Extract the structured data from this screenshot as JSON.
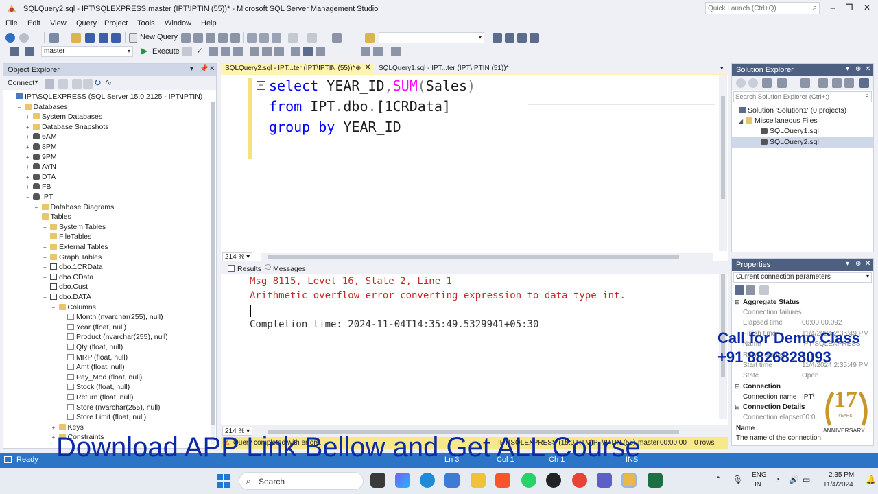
{
  "window": {
    "title": "SQLQuery2.sql - IPT\\SQLEXPRESS.master (IPT\\IPTIN (55))* - Microsoft SQL Server Management Studio",
    "quick_launch_placeholder": "Quick Launch (Ctrl+Q)"
  },
  "menu": [
    "File",
    "Edit",
    "View",
    "Query",
    "Project",
    "Tools",
    "Window",
    "Help"
  ],
  "toolbar": {
    "new_query": "New Query",
    "database": "master",
    "execute": "Execute"
  },
  "object_explorer": {
    "title": "Object Explorer",
    "connect": "Connect",
    "nodes": [
      {
        "label": "IPT\\SQLEXPRESS (SQL Server 15.0.2125 - IPT\\IPTIN)",
        "type": "server",
        "level": 0,
        "exp": "−"
      },
      {
        "label": "Databases",
        "type": "folder",
        "level": 1,
        "exp": "−"
      },
      {
        "label": "System Databases",
        "type": "folder",
        "level": 2,
        "exp": "+"
      },
      {
        "label": "Database Snapshots",
        "type": "folder",
        "level": 2,
        "exp": "+"
      },
      {
        "label": "6AM",
        "type": "db",
        "level": 2,
        "exp": "+"
      },
      {
        "label": "8PM",
        "type": "db",
        "level": 2,
        "exp": "+"
      },
      {
        "label": "9PM",
        "type": "db",
        "level": 2,
        "exp": "+"
      },
      {
        "label": "AYN",
        "type": "db",
        "level": 2,
        "exp": "+"
      },
      {
        "label": "DTA",
        "type": "db",
        "level": 2,
        "exp": "+"
      },
      {
        "label": "FB",
        "type": "db",
        "level": 2,
        "exp": "+"
      },
      {
        "label": "IPT",
        "type": "db",
        "level": 2,
        "exp": "−"
      },
      {
        "label": "Database Diagrams",
        "type": "folder",
        "level": 3,
        "exp": "+"
      },
      {
        "label": "Tables",
        "type": "folder",
        "level": 3,
        "exp": "−"
      },
      {
        "label": "System Tables",
        "type": "folder",
        "level": 4,
        "exp": "+"
      },
      {
        "label": "FileTables",
        "type": "folder",
        "level": 4,
        "exp": "+"
      },
      {
        "label": "External Tables",
        "type": "folder",
        "level": 4,
        "exp": "+"
      },
      {
        "label": "Graph Tables",
        "type": "folder",
        "level": 4,
        "exp": "+"
      },
      {
        "label": "dbo.1CRData",
        "type": "table",
        "level": 4,
        "exp": "+"
      },
      {
        "label": "dbo.CData",
        "type": "table",
        "level": 4,
        "exp": "+"
      },
      {
        "label": "dbo.Cust",
        "type": "table",
        "level": 4,
        "exp": "+"
      },
      {
        "label": "dbo.DATA",
        "type": "table",
        "level": 4,
        "exp": "−"
      },
      {
        "label": "Columns",
        "type": "folder",
        "level": 5,
        "exp": "−"
      },
      {
        "label": "Month (nvarchar(255), null)",
        "type": "column",
        "level": 6,
        "exp": ""
      },
      {
        "label": "Year (float, null)",
        "type": "column",
        "level": 6,
        "exp": ""
      },
      {
        "label": "Product (nvarchar(255), null)",
        "type": "column",
        "level": 6,
        "exp": ""
      },
      {
        "label": "Qty (float, null)",
        "type": "column",
        "level": 6,
        "exp": ""
      },
      {
        "label": "MRP (float, null)",
        "type": "column",
        "level": 6,
        "exp": ""
      },
      {
        "label": "Amt (float, null)",
        "type": "column",
        "level": 6,
        "exp": ""
      },
      {
        "label": "Pay_Mod (float, null)",
        "type": "column",
        "level": 6,
        "exp": ""
      },
      {
        "label": "Stock (float, null)",
        "type": "column",
        "level": 6,
        "exp": ""
      },
      {
        "label": "Return (float, null)",
        "type": "column",
        "level": 6,
        "exp": ""
      },
      {
        "label": "Store (nvarchar(255), null)",
        "type": "column",
        "level": 6,
        "exp": ""
      },
      {
        "label": "Store Limit (float, null)",
        "type": "column",
        "level": 6,
        "exp": ""
      },
      {
        "label": "Keys",
        "type": "folder",
        "level": 5,
        "exp": "+"
      },
      {
        "label": "Constraints",
        "type": "folder",
        "level": 5,
        "exp": "+"
      }
    ]
  },
  "editor": {
    "tabs": [
      {
        "label": "SQLQuery2.sql - IPT...ter (IPT\\IPTIN (55))*",
        "active": true
      },
      {
        "label": "SQLQuery1.sql - IPT...ter (IPT\\IPTIN (51))*",
        "active": false
      }
    ],
    "zoom": "214 %",
    "line1": {
      "kw": "select",
      "a": " YEAR_ID",
      "b": ",",
      "fn": "SUM",
      "c": "(",
      "d": "Sales",
      "e": ")"
    },
    "line2": {
      "kw": "from",
      "a": " IPT",
      "b": ".",
      "c": "dbo",
      "d": ".",
      "e": "[1CRData]"
    },
    "line3": {
      "kw": "group by",
      "a": " YEAR_ID"
    }
  },
  "results": {
    "tab_results": "Results",
    "tab_messages": "Messages",
    "msg1": "Msg 8115, Level 16, State 2, Line 1",
    "msg2": "Arithmetic overflow error converting expression to data type int.",
    "completion": "Completion time: 2024-11-04T14:35:49.5329941+05:30",
    "zoom": "214 %"
  },
  "query_status": {
    "text": "Query completed with errors.",
    "server": "IPT\\SQLEXPRESS (15.0 RTM)",
    "user": "IPT\\IPTIN (55)",
    "db": "master",
    "time": "00:00:00",
    "rows": "0 rows"
  },
  "statusbar": {
    "ready": "Ready",
    "ln": "Ln 3",
    "col": "Col 1",
    "ch": "Ch 1",
    "ins": "INS"
  },
  "solution_explorer": {
    "title": "Solution Explorer",
    "search_placeholder": "Search Solution Explorer (Ctrl+;)",
    "solution": "Solution 'Solution1' (0 projects)",
    "misc": "Miscellaneous Files",
    "file1": "SQLQuery1.sql",
    "file2": "SQLQuery2.sql"
  },
  "properties": {
    "title": "Properties",
    "selector": "Current connection parameters",
    "cat_aggregate": "Aggregate Status",
    "rows": [
      {
        "k": "Connection failures",
        "v": ""
      },
      {
        "k": "Elapsed time",
        "v": "00:00:00.092"
      },
      {
        "k": "Finish time",
        "v": "11/4/2024 2:35:49 PM"
      },
      {
        "k": "Name",
        "v": "IPT\\SQLEXPRESS"
      },
      {
        "k": "Rows returned",
        "v": "0"
      },
      {
        "k": "Start time",
        "v": "11/4/2024 2:35:49 PM"
      },
      {
        "k": "State",
        "v": "Open"
      }
    ],
    "cat_connection": "Connection",
    "conn_name_k": "Connection name",
    "conn_name_v": "IPT\\",
    "cat_details": "Connection Details",
    "conn_elapsed_k": "Connection elapsed",
    "conn_elapsed_v": "00:0",
    "desc_title": "Name",
    "desc_text": "The name of the connection."
  },
  "promo": {
    "line1": "Call for Demo Class",
    "line2": "+91 8826828093",
    "banner": "Download APP Link Bellow and Get ALL Course",
    "badge_number": "17",
    "badge_years": "YEARS",
    "badge_text": "ANNIVERSARY"
  },
  "taskbar": {
    "search": "Search",
    "lang1": "ENG",
    "lang2": "IN",
    "time": "2:35 PM",
    "date": "11/4/2024"
  },
  "colors": {
    "statusbar": "#2b74c6",
    "panel_header": "#4d6082",
    "active_tab": "#fff3b0",
    "error_text": "#c62828",
    "promo_text": "#0b2aa6"
  }
}
